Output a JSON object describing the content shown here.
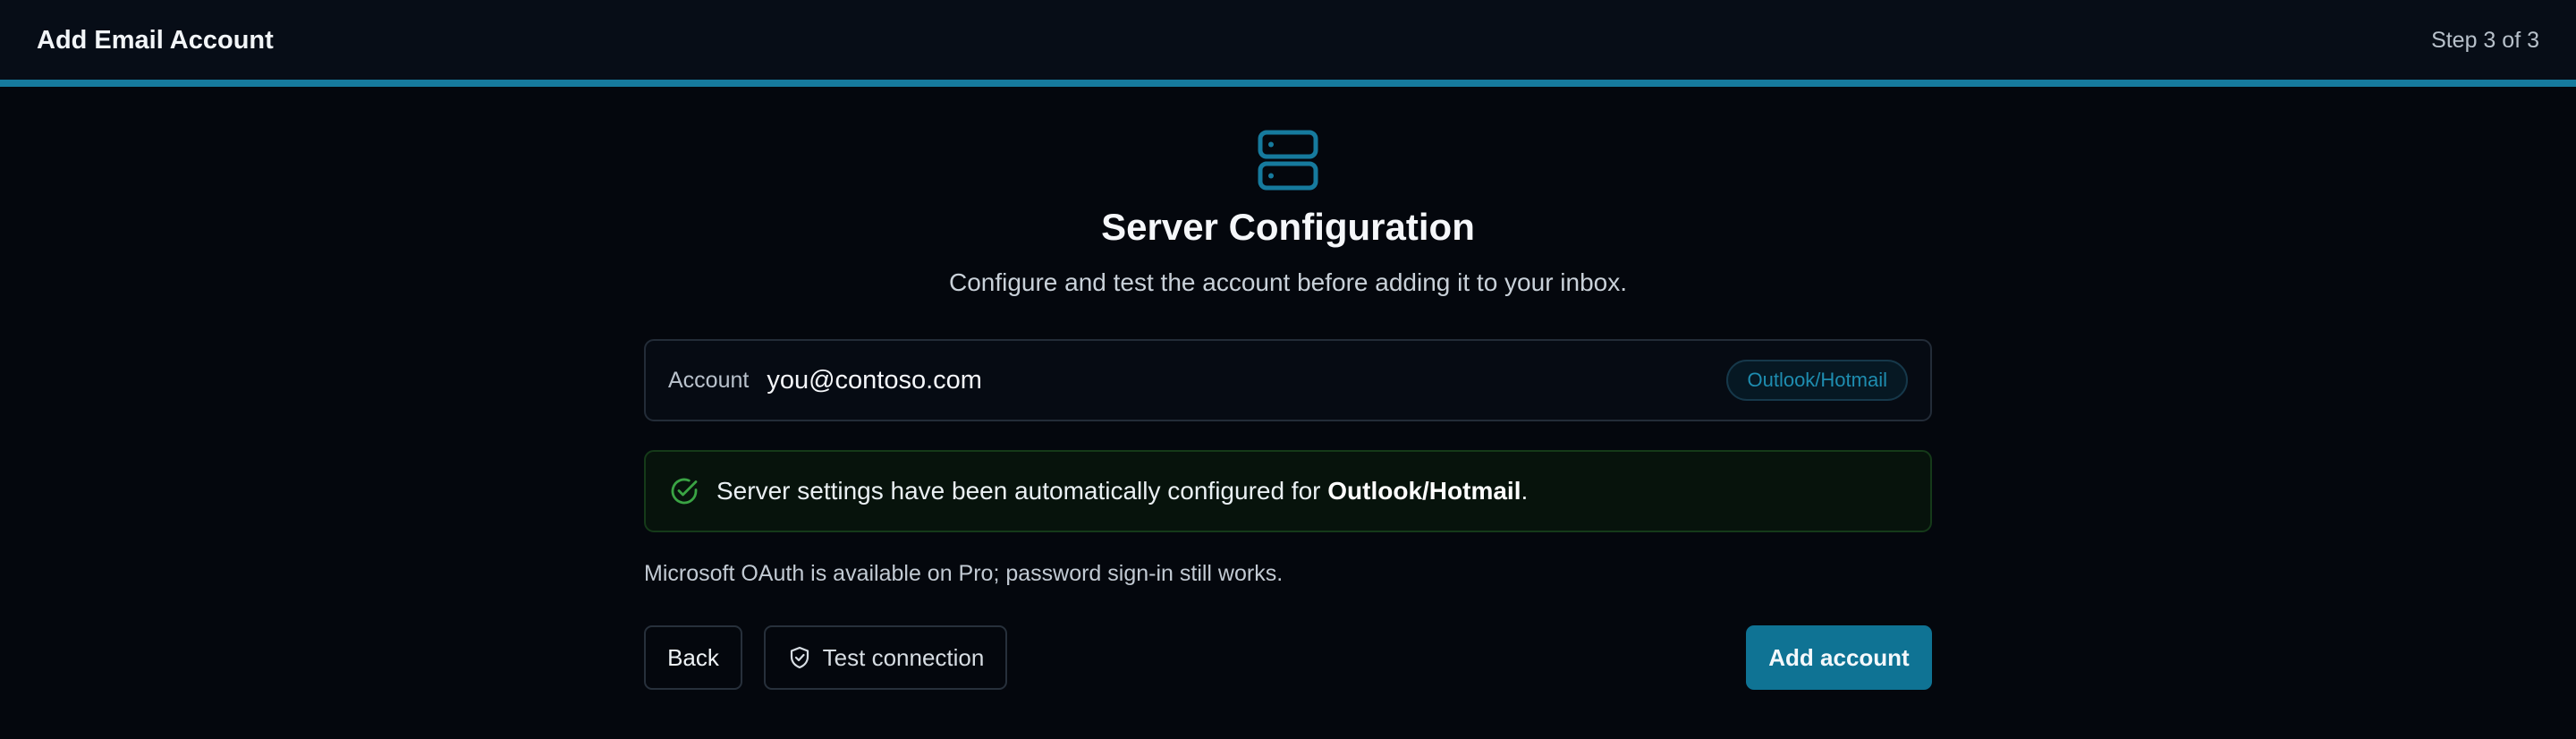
{
  "header": {
    "title": "Add Email Account",
    "step": "Step 3 of 3"
  },
  "hero": {
    "icon": "server-icon",
    "title": "Server Configuration",
    "subtitle": "Configure and test the account before adding it to your inbox."
  },
  "account": {
    "label": "Account",
    "email": "you@contoso.com",
    "provider_badge": "Outlook/Hotmail"
  },
  "status": {
    "icon": "check-circle-icon",
    "message": "Server settings have been automatically configured for ",
    "provider": "Outlook/Hotmail",
    "suffix": "."
  },
  "note": "Microsoft OAuth is available on Pro; password sign-in still works.",
  "actions": {
    "back_label": "Back",
    "test_label": "Test connection",
    "test_icon": "shield-check-icon",
    "add_label": "Add account"
  },
  "colors": {
    "accent": "#167a9d",
    "primary_button": "#0f7394",
    "success": "#3aa444",
    "background": "#04070d"
  }
}
